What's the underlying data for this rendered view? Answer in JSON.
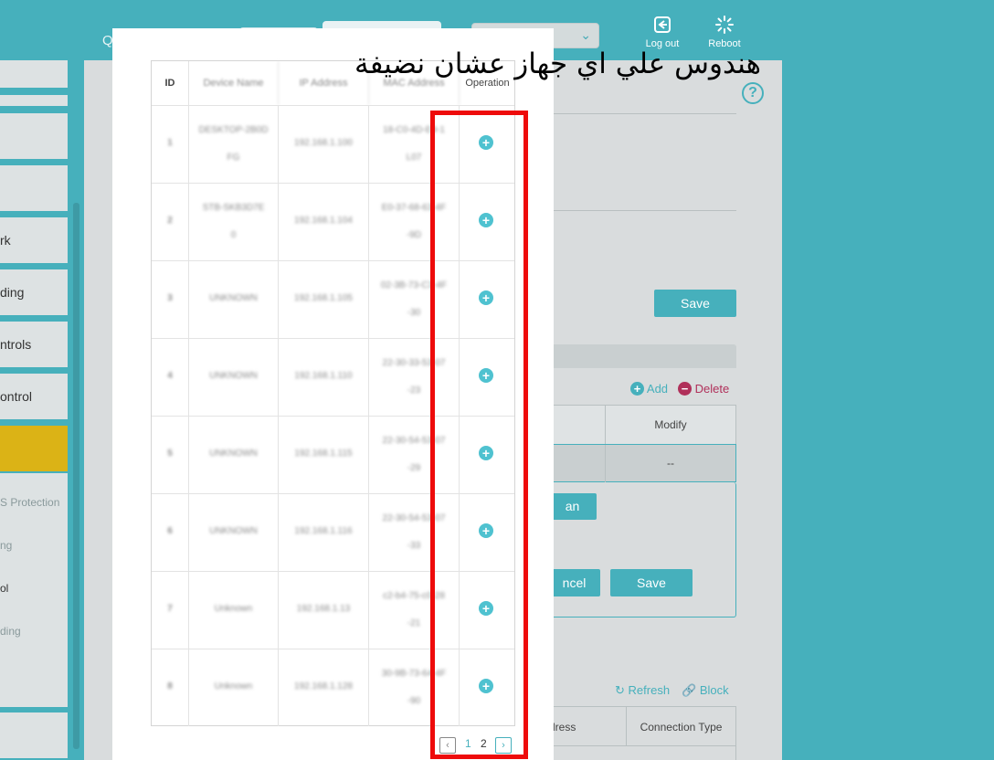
{
  "topbar": {
    "q_fragment": "Q",
    "logout_label": "Log out",
    "reboot_label": "Reboot",
    "select_chevron": "chevron-down-icon"
  },
  "sidebar": {
    "items": [
      {
        "label": ""
      },
      {
        "label": ""
      },
      {
        "label": ""
      },
      {
        "label": "rk"
      },
      {
        "label": "ding"
      },
      {
        "label": "ntrols"
      },
      {
        "label": "ontrol"
      },
      {
        "label": ""
      }
    ],
    "subitems": [
      {
        "label": "S Protection"
      },
      {
        "label": "ng"
      },
      {
        "label": "ol"
      },
      {
        "label": "ding"
      }
    ]
  },
  "main": {
    "save_label": "Save",
    "add_label": "Add",
    "delete_label": "Delete",
    "modify_header": "Modify",
    "modify_value": "--",
    "scan_fragment": "an",
    "cancel_fragment": "ncel",
    "save2_label": "Save",
    "refresh_label": "Refresh",
    "block_label": "Block",
    "address_header_fragment": "dress",
    "connection_type_header": "Connection Type",
    "help_icon": "?"
  },
  "modal": {
    "headers": {
      "id": "ID",
      "device_name": "Device Name",
      "ip_address": "IP Address",
      "mac_address": "MAC Address",
      "operation": "Operation"
    },
    "rows": [
      {
        "id": "1",
        "name_l1": "DESKTOP-2B0D",
        "name_l2": "FG",
        "ip": "192.168.1.100",
        "mac_l1": "18-C0-4D-E9-1",
        "mac_l2": "L07"
      },
      {
        "id": "2",
        "name_l1": "STB-SKB3D7E",
        "name_l2": "0",
        "ip": "192.168.1.104",
        "mac_l1": "E0-37-68-63-4F",
        "mac_l2": "-9D"
      },
      {
        "id": "3",
        "name_l1": "UNKNOWN",
        "name_l2": "",
        "ip": "192.168.1.105",
        "mac_l1": "02-3B-73-C3-4F",
        "mac_l2": "-30"
      },
      {
        "id": "4",
        "name_l1": "UNKNOWN",
        "name_l2": "",
        "ip": "192.168.1.110",
        "mac_l1": "22-30-33-53-07",
        "mac_l2": "-23"
      },
      {
        "id": "5",
        "name_l1": "UNKNOWN",
        "name_l2": "",
        "ip": "192.168.1.115",
        "mac_l1": "22-30-54-53-07",
        "mac_l2": "-29"
      },
      {
        "id": "6",
        "name_l1": "UNKNOWN",
        "name_l2": "",
        "ip": "192.168.1.116",
        "mac_l1": "22-30-54-53-07",
        "mac_l2": "-33"
      },
      {
        "id": "7",
        "name_l1": "Unknown",
        "name_l2": "",
        "ip": "192.168.1.13",
        "mac_l1": "c2-b4-75-c0-28",
        "mac_l2": "-21"
      },
      {
        "id": "8",
        "name_l1": "Unknown",
        "name_l2": "",
        "ip": "192.168.1.128",
        "mac_l1": "30-9B-73-64-4F",
        "mac_l2": "-90"
      }
    ],
    "add_icon": "+",
    "pagination": {
      "prev": "‹",
      "pages": [
        "1",
        "2"
      ],
      "current": "2",
      "next": "›"
    }
  },
  "annotation": {
    "text": "هندوس علي اي جهاز عشان نضيفة",
    "highlight_color": "#ee0b0b"
  },
  "colors": {
    "accent": "#46b0bc",
    "active_nav": "#dbb316",
    "delete": "#b0305a"
  }
}
